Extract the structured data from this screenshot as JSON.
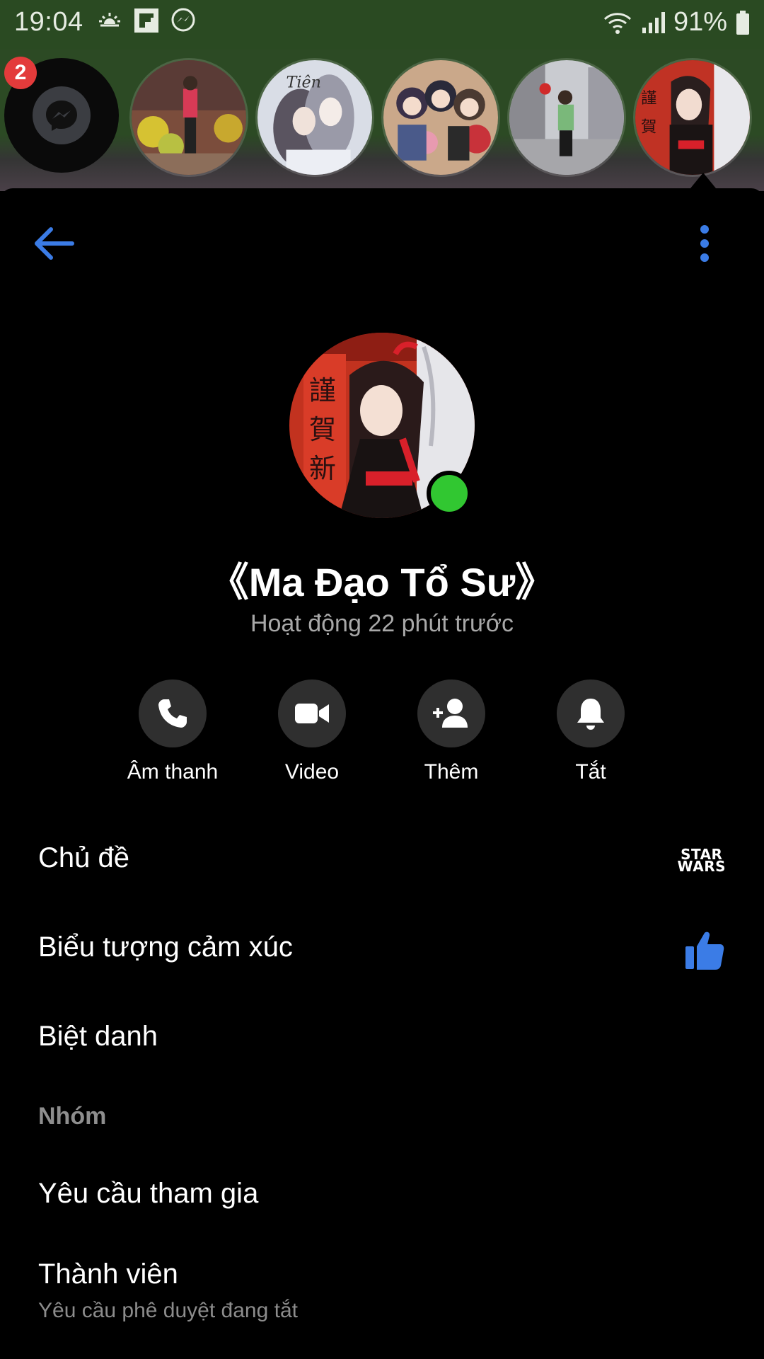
{
  "status_bar": {
    "time": "19:04",
    "battery": "91%"
  },
  "chat_heads": {
    "unread_badge": "2"
  },
  "header": {
    "back_icon": "arrow-left-icon",
    "menu_icon": "more-vertical-icon"
  },
  "profile": {
    "name": "《Ma Đạo Tổ Sư》",
    "status": "Hoạt động 22 phút trước"
  },
  "actions": [
    {
      "label": "Âm thanh",
      "icon": "phone-icon"
    },
    {
      "label": "Video",
      "icon": "video-camera-icon"
    },
    {
      "label": "Thêm",
      "icon": "add-person-icon"
    },
    {
      "label": "Tắt",
      "icon": "bell-icon"
    }
  ],
  "settings": {
    "theme": {
      "label": "Chủ đề",
      "value_logo": "STAR WARS"
    },
    "emoji": {
      "label": "Biểu tượng cảm xúc",
      "icon": "thumbs-up-icon"
    },
    "nickname": {
      "label": "Biệt danh"
    },
    "group_section": "Nhóm",
    "join_requests": {
      "label": "Yêu cầu tham gia"
    },
    "members": {
      "label": "Thành viên",
      "sublabel": "Yêu cầu phê duyệt đang tắt"
    }
  },
  "colors": {
    "accent_blue": "#3b7ce6",
    "online_green": "#31c731",
    "status_bar_bg": "#2a4a22"
  }
}
